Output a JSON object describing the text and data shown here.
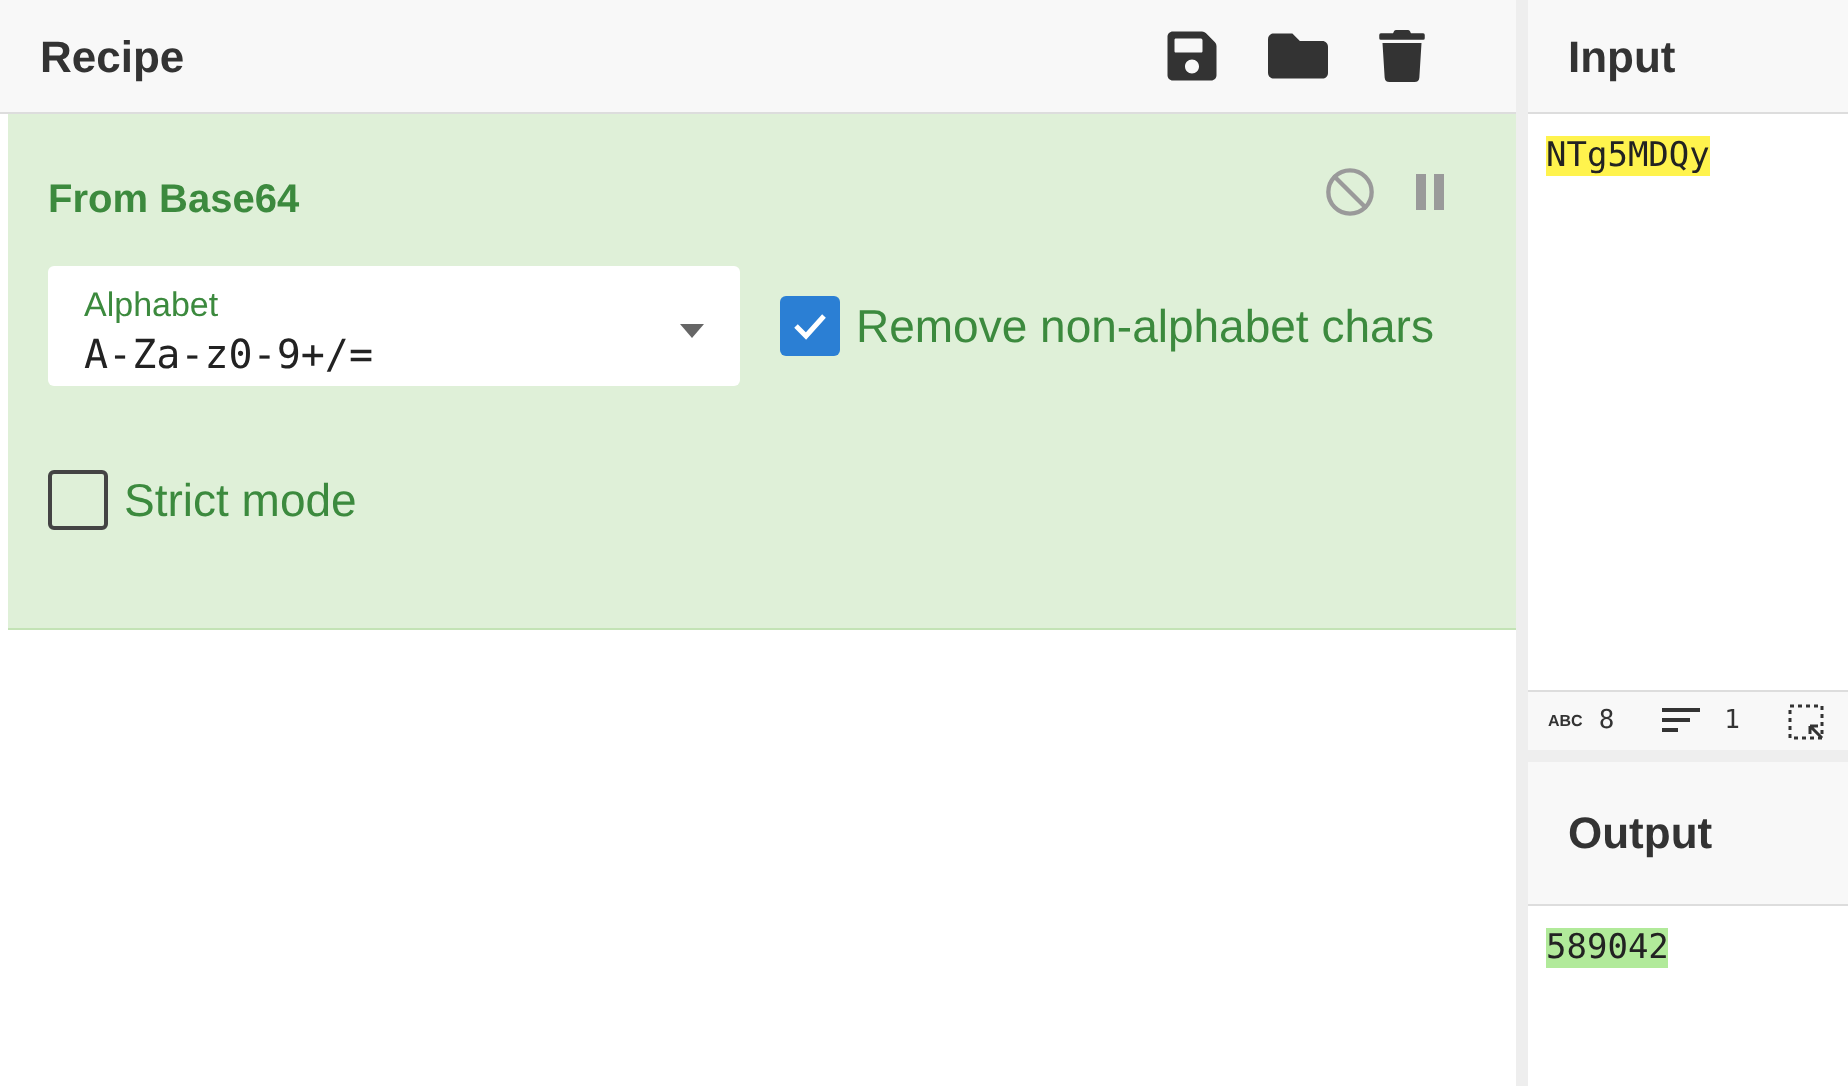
{
  "recipe": {
    "title": "Recipe",
    "operations": [
      {
        "name": "From Base64",
        "field": {
          "label": "Alphabet",
          "value": "A-Za-z0-9+/="
        },
        "options": [
          {
            "label": "Remove non-alphabet chars",
            "checked": true
          },
          {
            "label": "Strict mode",
            "checked": false
          }
        ]
      }
    ]
  },
  "input": {
    "title": "Input",
    "value": "NTg5MDQy",
    "status": {
      "length_label": "ABC",
      "length": "8",
      "lines": "1"
    }
  },
  "output": {
    "title": "Output",
    "value": "589042"
  }
}
